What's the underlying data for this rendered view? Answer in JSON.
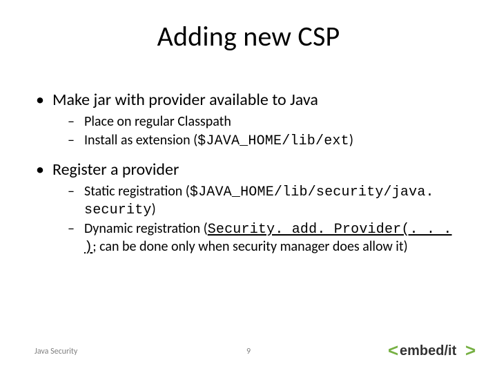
{
  "title": "Adding new CSP",
  "bullets": [
    {
      "text": "Make jar with provider available to Java",
      "sub": [
        {
          "parts": [
            {
              "t": "Place on regular Classpath"
            }
          ]
        },
        {
          "parts": [
            {
              "t": "Install as extension ("
            },
            {
              "t": "$JAVA_HOME/lib/ext",
              "mono": true
            },
            {
              "t": ")"
            }
          ]
        }
      ]
    },
    {
      "text": "Register a provider",
      "sub": [
        {
          "parts": [
            {
              "t": "Static registration ("
            },
            {
              "t": "$JAVA_HOME/lib/security/java. security",
              "mono": true
            },
            {
              "t": ")"
            }
          ]
        },
        {
          "parts": [
            {
              "t": "Dynamic registration ("
            },
            {
              "t": "Security. add. Provider(. . . )",
              "mono": true,
              "underline": true
            },
            {
              "t": "; can be done only when security manager does allow it)"
            }
          ]
        }
      ]
    }
  ],
  "footer": {
    "left": "Java Security",
    "page": "9"
  },
  "logo": {
    "bracket_color": "#76b043",
    "text_color": "#333333",
    "text": "embed/it"
  }
}
